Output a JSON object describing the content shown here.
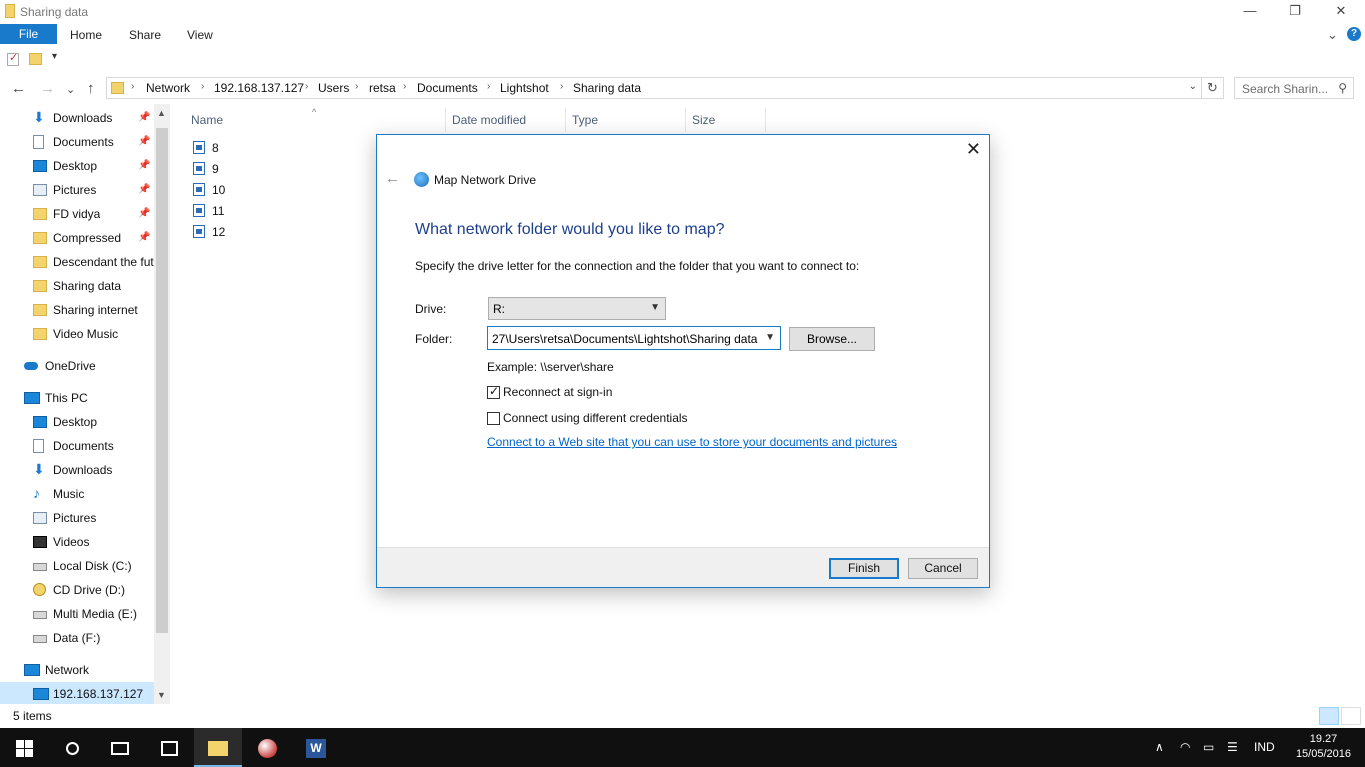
{
  "window": {
    "title": "Sharing data",
    "minimize": "—",
    "restore": "❐",
    "close": "✕"
  },
  "ribbon": {
    "tabs": [
      "File",
      "Home",
      "Share",
      "View"
    ],
    "expand": "⌄",
    "help": "?"
  },
  "qat": {
    "customize": "▾"
  },
  "nav_buttons": {
    "back": "←",
    "forward": "→",
    "recent": "⌄",
    "up": "↑"
  },
  "address": {
    "crumbs": [
      "Network",
      "192.168.137.127",
      "Users",
      "retsa",
      "Documents",
      "Lightshot",
      "Sharing data"
    ],
    "separator": "›",
    "dropdown": "⌄",
    "refresh": "↻"
  },
  "search": {
    "placeholder": "Search Sharin...",
    "icon": "⚲"
  },
  "nav_pane": {
    "items": [
      {
        "label": "Downloads",
        "icon": "download-icon",
        "pinned": true
      },
      {
        "label": "Documents",
        "icon": "documents-icon",
        "pinned": true
      },
      {
        "label": "Desktop",
        "icon": "desktop-icon",
        "pinned": true
      },
      {
        "label": "Pictures",
        "icon": "pictures-icon",
        "pinned": true
      },
      {
        "label": "FD vidya",
        "icon": "folder-icon",
        "pinned": true
      },
      {
        "label": "Compressed",
        "icon": "folder-icon",
        "pinned": true
      },
      {
        "label": "Descendant the fut",
        "icon": "folder-icon",
        "pinned": false
      },
      {
        "label": "Sharing data",
        "icon": "folder-icon",
        "pinned": false
      },
      {
        "label": "Sharing internet",
        "icon": "folder-icon",
        "pinned": false
      },
      {
        "label": "Video Music",
        "icon": "folder-icon",
        "pinned": false
      },
      {
        "label": "OneDrive",
        "icon": "onedrive-icon",
        "pinned": false
      },
      {
        "label": "This PC",
        "icon": "this-pc-icon",
        "pinned": false
      },
      {
        "label": "Desktop",
        "icon": "desktop-icon",
        "pinned": false
      },
      {
        "label": "Documents",
        "icon": "documents-icon",
        "pinned": false
      },
      {
        "label": "Downloads",
        "icon": "download-icon",
        "pinned": false
      },
      {
        "label": "Music",
        "icon": "music-icon",
        "pinned": false
      },
      {
        "label": "Pictures",
        "icon": "pictures-icon",
        "pinned": false
      },
      {
        "label": "Videos",
        "icon": "videos-icon",
        "pinned": false
      },
      {
        "label": "Local Disk (C:)",
        "icon": "disk-icon",
        "pinned": false
      },
      {
        "label": "CD Drive (D:)",
        "icon": "cd-icon",
        "pinned": false
      },
      {
        "label": "Multi Media (E:)",
        "icon": "disk-icon",
        "pinned": false
      },
      {
        "label": "Data (F:)",
        "icon": "disk-icon",
        "pinned": false
      },
      {
        "label": "Network",
        "icon": "network-icon",
        "pinned": false
      },
      {
        "label": "192.168.137.127",
        "icon": "computer-icon",
        "pinned": false,
        "selected": true
      }
    ],
    "pin_glyph": "📌"
  },
  "file_list": {
    "columns": [
      "Name",
      "Date modified",
      "Type",
      "Size"
    ],
    "files": [
      "8",
      "9",
      "10",
      "11",
      "12"
    ]
  },
  "status": {
    "count": "5 items"
  },
  "taskbar": {
    "language": "IND",
    "time": "19.27",
    "date": "15/05/2016"
  },
  "dialog": {
    "title": "Map Network Drive",
    "heading": "What network folder would you like to map?",
    "instruction": "Specify the drive letter for the connection and the folder that you want to connect to:",
    "drive_label": "Drive:",
    "drive_value": "R:",
    "folder_label": "Folder:",
    "folder_value": "27\\Users\\retsa\\Documents\\Lightshot\\Sharing data",
    "browse": "Browse...",
    "example": "Example: \\\\server\\share",
    "reconnect_label": "Reconnect at sign-in",
    "reconnect_checked": true,
    "credentials_label": "Connect using different credentials",
    "credentials_checked": false,
    "link": "Connect to a Web site that you can use to store your documents and pictures",
    "link_suffix": ".",
    "finish": "Finish",
    "cancel": "Cancel",
    "close": "✕",
    "back": "←"
  },
  "colors": {
    "accent": "#1979ca",
    "heading": "#1e3f8c",
    "link": "#0066cc",
    "selection": "#cce8ff",
    "taskbar": "#101010"
  }
}
